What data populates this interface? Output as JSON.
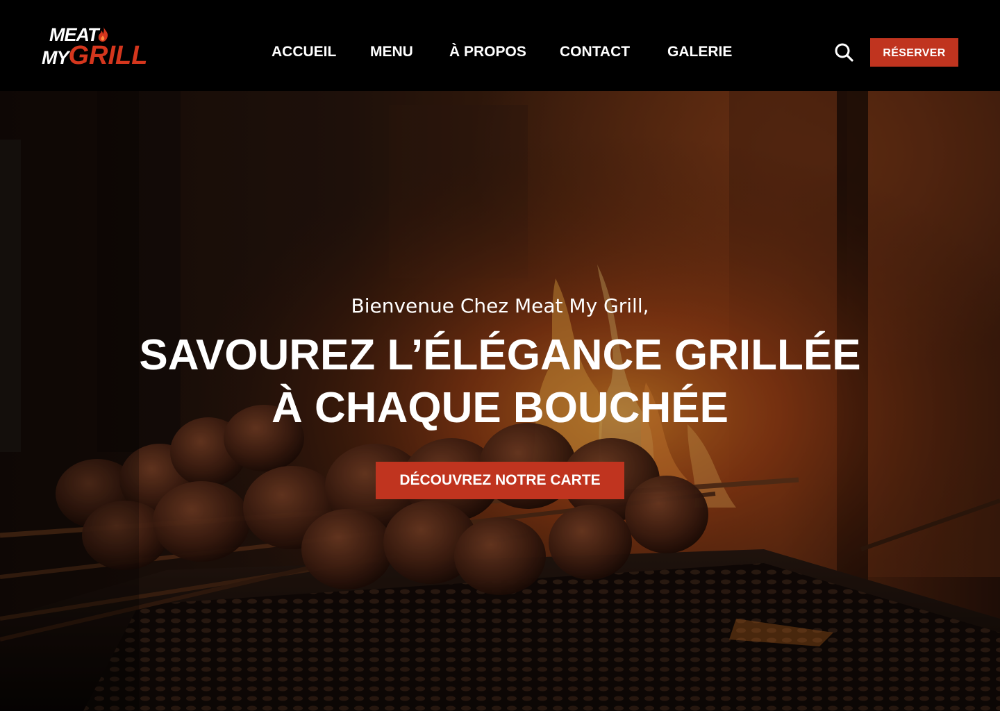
{
  "brand": {
    "logo_line1": "MEAT",
    "logo_my": "MY",
    "logo_grill": "GRILL",
    "accent_color": "#c0341f"
  },
  "nav": {
    "items": [
      {
        "label": "ACCUEIL"
      },
      {
        "label": "MENU"
      },
      {
        "label": "À PROPOS"
      },
      {
        "label": "CONTACT"
      },
      {
        "label": "GALERIE"
      }
    ],
    "search_icon": "search-icon",
    "reserve_label": "RÉSERVER"
  },
  "hero": {
    "welcome": "Bienvenue Chez Meat My Grill,",
    "title_line1": "SAVOUREZ L’ÉLÉGANCE GRILLÉE",
    "title_line2": "À CHAQUE BOUCHÉE",
    "cta_label": "DÉCOUVREZ NOTRE CARTE",
    "background": "grilled skewers over flames"
  }
}
